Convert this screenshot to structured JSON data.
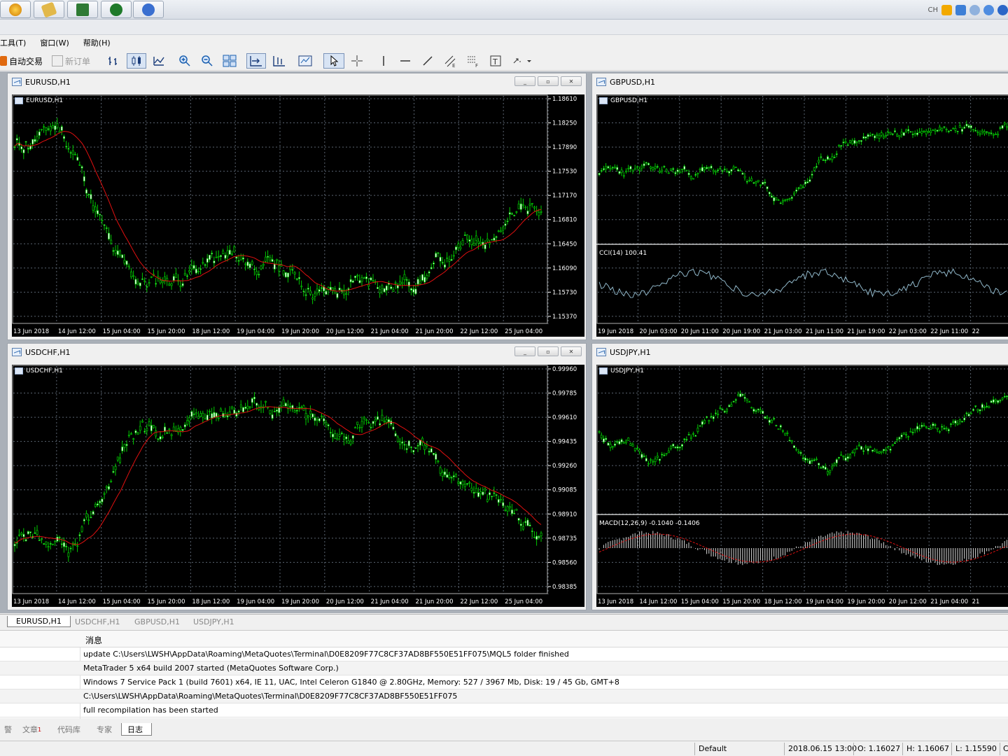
{
  "taskbar": {
    "tray_text": "CH"
  },
  "menu": {
    "items": [
      "工具(T)",
      "窗口(W)",
      "帮助(H)"
    ]
  },
  "toolbar": {
    "auto_trade": "自动交易",
    "new_order": "新订单"
  },
  "windows": [
    {
      "title": "EURUSD,H1",
      "chart_label": "EURUSD,H1",
      "price_ticks": [
        "1.18610",
        "1.18250",
        "1.17890",
        "1.17530",
        "1.17170",
        "1.16810",
        "1.16450",
        "1.16090",
        "1.15730",
        "1.15370"
      ],
      "time_ticks": [
        "13 Jun 2018",
        "14 Jun 12:00",
        "15 Jun 04:00",
        "15 Jun 20:00",
        "18 Jun 12:00",
        "19 Jun 04:00",
        "19 Jun 20:00",
        "20 Jun 12:00",
        "21 Jun 04:00",
        "21 Jun 20:00",
        "22 Jun 12:00",
        "25 Jun 04:00"
      ]
    },
    {
      "title": "GBPUSD,H1",
      "chart_label": "GBPUSD,H1",
      "indicator_label": "CCI(14) 100.41",
      "time_ticks": [
        "19 Jun 2018",
        "20 Jun 03:00",
        "20 Jun 11:00",
        "20 Jun 19:00",
        "21 Jun 03:00",
        "21 Jun 11:00",
        "21 Jun 19:00",
        "22 Jun 03:00",
        "22 Jun 11:00",
        "22"
      ]
    },
    {
      "title": "USDCHF,H1",
      "chart_label": "USDCHF,H1",
      "price_ticks": [
        "0.99960",
        "0.99785",
        "0.99610",
        "0.99435",
        "0.99260",
        "0.99085",
        "0.98910",
        "0.98735",
        "0.98560",
        "0.98385"
      ],
      "time_ticks": [
        "13 Jun 2018",
        "14 Jun 12:00",
        "15 Jun 04:00",
        "15 Jun 20:00",
        "18 Jun 12:00",
        "19 Jun 04:00",
        "19 Jun 20:00",
        "20 Jun 12:00",
        "21 Jun 04:00",
        "21 Jun 20:00",
        "22 Jun 12:00",
        "25 Jun 04:00"
      ]
    },
    {
      "title": "USDJPY,H1",
      "chart_label": "USDJPY,H1",
      "indicator_label": "MACD(12,26,9) -0.1040 -0.1406",
      "time_ticks": [
        "13 Jun 2018",
        "14 Jun 12:00",
        "15 Jun 04:00",
        "15 Jun 20:00",
        "18 Jun 12:00",
        "19 Jun 04:00",
        "19 Jun 20:00",
        "20 Jun 12:00",
        "21 Jun 04:00",
        "21"
      ]
    }
  ],
  "chart_tabs": [
    "EURUSD,H1",
    "USDCHF,H1",
    "GBPUSD,H1",
    "USDJPY,H1"
  ],
  "log": {
    "header": "消息",
    "rows": [
      "update C:\\Users\\LWSH\\AppData\\Roaming\\MetaQuotes\\Terminal\\D0E8209F77C8CF37AD8BF550E51FF075\\MQL5 folder finished",
      "MetaTrader 5 x64 build 2007 started (MetaQuotes Software Corp.)",
      "Windows 7 Service Pack 1 (build 7601) x64, IE 11, UAC, Intel Celeron  G1840 @ 2.80GHz, Memory: 527 / 3967 Mb, Disk: 19 / 45 Gb, GMT+8",
      "C:\\Users\\LWSH\\AppData\\Roaming\\MetaQuotes\\Terminal\\D0E8209F77C8CF37AD8BF550E51FF075",
      "full recompilation has been started"
    ]
  },
  "bottom_tabs": [
    "警",
    "文章",
    "代码库",
    "专家",
    "日志"
  ],
  "bottom_tab_badge": "1",
  "status": {
    "profile": "Default",
    "datetime": "2018.06.15 13:00",
    "open": "O: 1.16027",
    "high": "H: 1.16067",
    "low": "L: 1.15590",
    "close": "C"
  },
  "colors": {
    "bull": "#00c800",
    "bear": "#00c800",
    "ma": "#e01010",
    "grid": "#5a6470",
    "indicator": "#8fb6c8"
  }
}
